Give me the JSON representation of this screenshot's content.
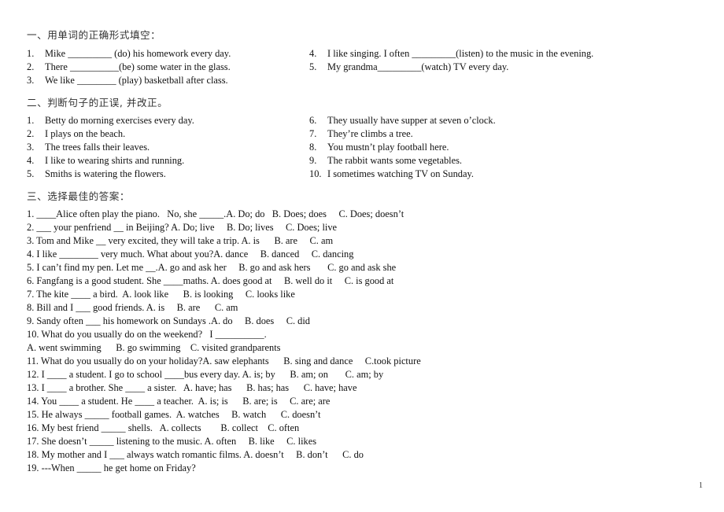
{
  "section1": {
    "heading": "一、用单词的正确形式填空：",
    "left_items": [
      {
        "num": "1.",
        "text": "Mike _________ (do) his homework every day."
      },
      {
        "num": "2.",
        "text": "There __________(be) some water in the glass."
      },
      {
        "num": "3.",
        "text": "We like ________ (play) basketball after class."
      }
    ],
    "right_items": [
      {
        "num": "4.",
        "text": "I like singing. I often _________(listen) to the music in the evening."
      },
      {
        "num": "5.",
        "text": "My grandma_________(watch) TV every day."
      }
    ]
  },
  "section2": {
    "heading": "二、判断句子的正误, 并改正。",
    "left_items": [
      {
        "num": "1.",
        "text": "Betty do morning exercises every day."
      },
      {
        "num": "2.",
        "text": "I plays on the beach."
      },
      {
        "num": "3.",
        "text": "The trees falls their leaves."
      },
      {
        "num": "4.",
        "text": "I like to wearing shirts and running."
      },
      {
        "num": "5.",
        "text": "Smiths is watering the flowers."
      }
    ],
    "right_items": [
      {
        "num": "6.",
        "text": "They usually have supper at seven o’clock."
      },
      {
        "num": "7.",
        "text": "They’re climbs a tree."
      },
      {
        "num": "8.",
        "text": "You mustn’t play football here."
      },
      {
        "num": "9.",
        "text": "The rabbit wants some vegetables."
      },
      {
        "num": "10.",
        "text": "I sometimes watching TV on Sunday."
      }
    ]
  },
  "section3": {
    "heading": "三、选择最佳的答案：",
    "lines": [
      "1. ____Alice often play the piano.   No, she _____.A. Do; do   B. Does; does     C. Does; doesn’t",
      "2. ___ your penfriend __ in Beijing? A. Do; live     B. Do; lives     C. Does; live",
      "3. Tom and Mike __ very excited, they will take a trip. A. is      B. are     C. am",
      "4. I like ________ very much. What about you?A. dance     B. danced     C. dancing",
      "5. I can’t find my pen. Let me __.A. go and ask her     B. go and ask hers       C. go and ask she",
      "6. Fangfang is a good student. She ____maths. A. does good at     B. well do it     C. is good at",
      "7. The kite ____ a bird.  A. look like      B. is looking     C. looks like",
      "8. Bill and I ___ good friends. A. is     B. are      C. am",
      "9. Sandy often ___ his homework on Sundays .A. do     B. does     C. did",
      "10. What do you usually do on the weekend?   I __________.",
      "A. went swimming      B. go swimming    C. visited grandparents",
      "11. What do you usually do on your holiday?A. saw elephants      B. sing and dance     C.took picture",
      "12. I ____ a student. I go to school ____bus every day. A. is; by      B. am; on       C. am; by",
      "13. I ____ a brother. She ____ a sister.   A. have; has      B. has; has      C. have; have",
      "14. You ____ a student. He ____ a teacher.  A. is; is      B. are; is     C. are; are",
      "15. He always _____ football games.  A. watches     B. watch      C. doesn’t",
      "16. My best friend _____ shells.   A. collects        B. collect    C. often",
      "17. She doesn’t _____ listening to the music. A. often     B. like     C. likes",
      "18. My mother and I ___ always watch romantic films. A. doesn’t     B. don’t      C. do",
      "19. ---When _____ he get home on Friday?"
    ]
  },
  "footer": {
    "page_number": "1"
  }
}
